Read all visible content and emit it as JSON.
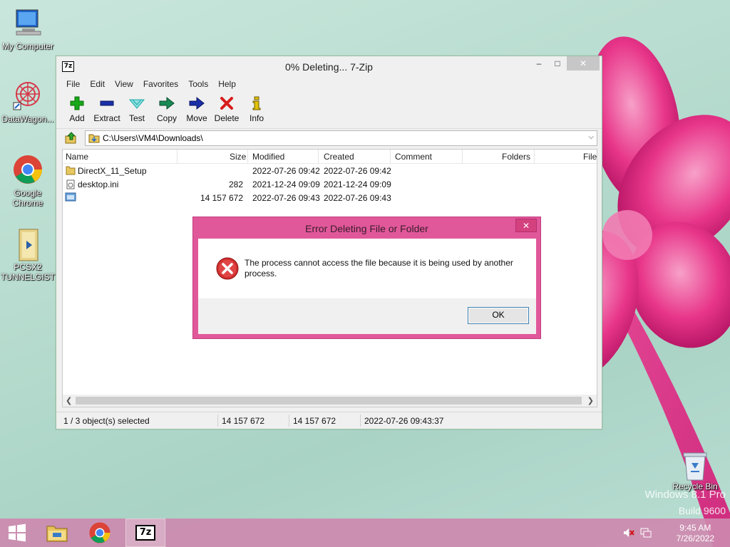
{
  "desktop": {
    "icons": [
      {
        "label": "My Computer"
      },
      {
        "label": "DataWagon..."
      },
      {
        "label": "Google Chrome"
      },
      {
        "label": "PCSX2 TUNNELGIST"
      },
      {
        "label": "Recycle Bin"
      }
    ],
    "watermark": {
      "line1": "Windows 8.1 Pro",
      "line2": "Build 9600"
    }
  },
  "window": {
    "title": "0% Deleting... 7-Zip",
    "app_icon": "7z",
    "controls": {
      "minimize": "–",
      "maximize": "□",
      "close": "✕"
    },
    "menu": [
      "File",
      "Edit",
      "View",
      "Favorites",
      "Tools",
      "Help"
    ],
    "toolbar": [
      {
        "label": "Add",
        "icon": "add-icon",
        "color": "#19a81a"
      },
      {
        "label": "Extract",
        "icon": "extract-icon",
        "color": "#1a2fa8"
      },
      {
        "label": "Test",
        "icon": "test-icon",
        "color": "#1aa8a8"
      },
      {
        "label": "Copy",
        "icon": "copy-icon",
        "color": "#1a8a55"
      },
      {
        "label": "Move",
        "icon": "move-icon",
        "color": "#1a2fa8"
      },
      {
        "label": "Delete",
        "icon": "delete-icon",
        "color": "#d81c1c"
      },
      {
        "label": "Info",
        "icon": "info-icon",
        "color": "#c9a800"
      }
    ],
    "address": "C:\\Users\\VM4\\Downloads\\",
    "columns": [
      "Name",
      "Size",
      "Modified",
      "Created",
      "Comment",
      "Folders",
      "File"
    ],
    "files": [
      {
        "name": "DirectX_11_Setup",
        "size": "",
        "modified": "2022-07-26 09:42",
        "created": "2022-07-26 09:42",
        "type": "folder"
      },
      {
        "name": "desktop.ini",
        "size": "282",
        "modified": "2021-12-24 09:09",
        "created": "2021-12-24 09:09",
        "type": "ini"
      },
      {
        "name": "",
        "size": "14 157 672",
        "modified": "2022-07-26 09:43",
        "created": "2022-07-26 09:43",
        "type": "file"
      }
    ],
    "status": {
      "selection": "1 / 3 object(s) selected",
      "size1": "14 157 672",
      "size2": "14 157 672",
      "date": "2022-07-26 09:43:37"
    }
  },
  "dialog": {
    "title": "Error Deleting File or Folder",
    "close": "✕",
    "message": "The process cannot access the file because it is being used by another process.",
    "ok_label": "OK"
  },
  "taskbar": {
    "clock_time": "9:45 AM",
    "clock_date": "7/26/2022",
    "pinned": [
      "start-button",
      "file-explorer",
      "google-chrome",
      "7-zip"
    ]
  },
  "colors": {
    "dialog_frame": "#e1589a",
    "taskbar": "#cd8aaf",
    "wallpaper_bg": "#b7dccf",
    "flower": "#e8368a"
  }
}
